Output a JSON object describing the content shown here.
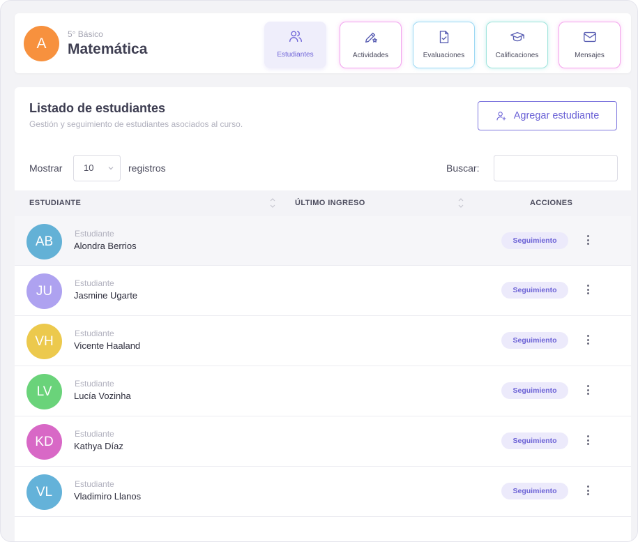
{
  "course": {
    "avatar_letter": "A",
    "avatar_color": "#f7913e",
    "grade": "5° Básico",
    "name": "Matemática"
  },
  "nav": {
    "tabs": [
      {
        "label": "Estudiantes",
        "icon": "users-icon",
        "active": true
      },
      {
        "label": "Actividades",
        "icon": "pencil-star-icon",
        "active": false
      },
      {
        "label": "Evaluaciones",
        "icon": "document-check-icon",
        "active": false
      },
      {
        "label": "Calificaciones",
        "icon": "graduation-cap-icon",
        "active": false
      },
      {
        "label": "Mensajes",
        "icon": "envelope-icon",
        "active": false
      }
    ]
  },
  "list": {
    "title": "Listado de estudiantes",
    "subtitle": "Gestión y seguimiento de estudiantes asociados al curso.",
    "add_button": "Agregar estudiante",
    "show_label": "Mostrar",
    "page_size": "10",
    "records_label": "registros",
    "search_label": "Buscar:",
    "search_value": "",
    "columns": {
      "student": "ESTUDIANTE",
      "last_login": "ÚLTIMO INGRESO",
      "actions": "ACCIONES"
    }
  },
  "students": [
    {
      "initials": "AB",
      "role": "Estudiante",
      "name": "Alondra Berrios",
      "color": "#63b1d6",
      "last_login": "",
      "action": "Seguimiento"
    },
    {
      "initials": "JU",
      "role": "Estudiante",
      "name": "Jasmine Ugarte",
      "color": "#aea2f0",
      "last_login": "",
      "action": "Seguimiento"
    },
    {
      "initials": "VH",
      "role": "Estudiante",
      "name": "Vicente Haaland",
      "color": "#ecc94d",
      "last_login": "",
      "action": "Seguimiento"
    },
    {
      "initials": "LV",
      "role": "Estudiante",
      "name": "Lucía Vozinha",
      "color": "#6ad37a",
      "last_login": "",
      "action": "Seguimiento"
    },
    {
      "initials": "KD",
      "role": "Estudiante",
      "name": "Kathya Díaz",
      "color": "#d868c6",
      "last_login": "",
      "action": "Seguimiento"
    },
    {
      "initials": "VL",
      "role": "Estudiante",
      "name": "Vladimiro Llanos",
      "color": "#64b2d9",
      "last_login": "",
      "action": "Seguimiento"
    }
  ],
  "colors": {
    "accent": "#6f64d8",
    "badge_bg": "#eceafb"
  }
}
